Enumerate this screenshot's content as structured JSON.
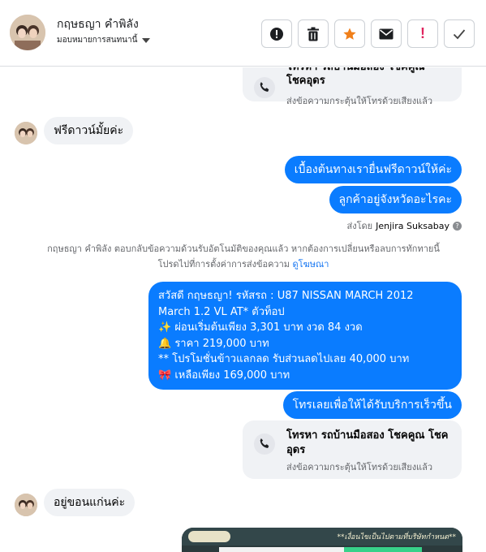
{
  "header": {
    "contact_name": "กฤษธญา คำพิลัง",
    "assign_label": "มอบหมายการสนทนานี้"
  },
  "toolbar": {
    "spam": "spam-icon",
    "delete": "trash-icon",
    "star": "star-icon",
    "mail": "envelope-icon",
    "important": "!",
    "done": "check-icon",
    "star_color": "#f07f1a",
    "important_color": "#e0245e"
  },
  "thread": {
    "top_card": {
      "title_partial": "โทรหา รถบ้านมือสอง โชคคูณ",
      "title_line2": "โชคอุดร",
      "subtitle": "ส่งข้อความกระตุ้นให้โทรด้วยเสียงแล้ว"
    },
    "msg_in_1": "ฟรีดาวน์มั้ยค่ะ",
    "msg_out_1": "เบื้องต้นทางเรายื่นฟรีดาวน์ให้ค่ะ",
    "msg_out_2": "ลูกค้าอยู่จังหวัดอะไรคะ",
    "sent_by_label": "ส่งโดย",
    "sent_by_name": "Jenjira Suksabay",
    "system_note_line1": "กฤษธญา คำพิลัง ตอบกลับข้อความด้วนรับอัตโนมัติของคุณแล้ว หากต้องการเปลี่ยนหรือลบการทักทายนี้",
    "system_note_line2": "โปรดไปที่การตั้งค่าการส่งข้อความ",
    "system_note_link": "ดูโฆษณา",
    "long_msg": [
      "สวัสดี กฤษธญา!   รหัสรถ : U87  NISSAN MARCH 2012",
      "March 1.2 VL AT* ตัวท็อป",
      "✨  ผ่อนเริ่มต้นเพียง 3,301 บาท งวด 84 งวด",
      "🔔 ราคา 219,000 บาท",
      "**  โปรโมชั่นข้าวแลกลด รับส่วนลดไปเลย 40,000 บาท",
      "🎀 เหลือเพียง 169,000 บาท"
    ],
    "msg_out_3": "โทรเลยเพื่อให้ได้รับบริการเร็วขึ้น",
    "call_card": {
      "title": "โทรหา รถบ้านมือสอง โชคคูณ โชคอุดร",
      "subtitle": "ส่งข้อความกระตุ้นให้โทรด้วยเสียงแล้ว"
    },
    "msg_in_2": "อยู่ขอนแก่นค่ะ",
    "image_caption": "**เงื่อนไขเป็นไปตามที่บริษัทกำหนด**"
  },
  "colors": {
    "outgoing_bubble": "#0a7cff",
    "incoming_bubble": "#f0f2f5",
    "link": "#1877f2"
  }
}
